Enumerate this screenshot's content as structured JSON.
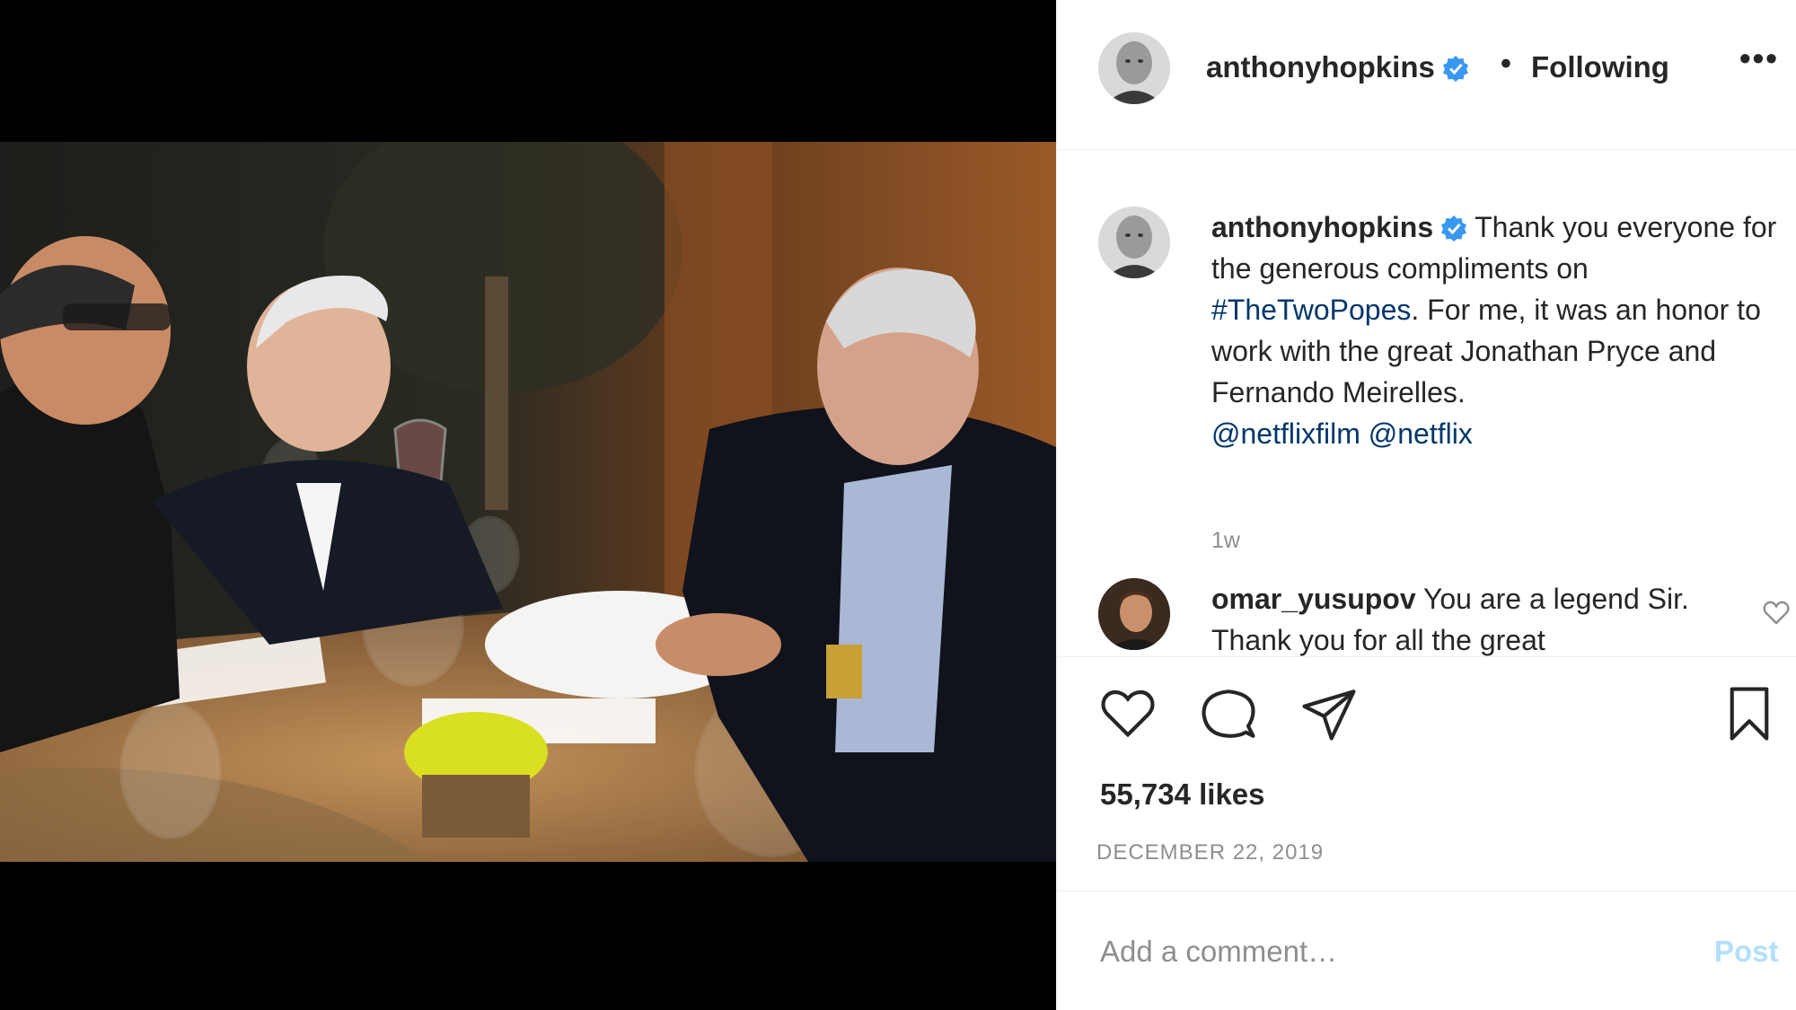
{
  "post": {
    "author": "anthonyhopkins",
    "follow_status": "Following",
    "separator": "•",
    "more_icon": "more-horizontal-icon",
    "more_label": "•••",
    "verified_color": "#3897f0"
  },
  "caption": {
    "username": "anthonyhopkins",
    "text_before": "Thank you everyone for the generous compliments on ",
    "hashtag": "#TheTwoPopes",
    "text_after": ". For me, it was an honor to work with the great Jonathan Pryce and Fernando Meirelles.",
    "mention_1": "@netflixfilm",
    "mention_2": "@netflix",
    "time": "1w"
  },
  "comment": {
    "username": "omar_yusupov",
    "text": "You are a legend Sir. Thank you for all the great"
  },
  "engagement": {
    "likes": "55,734 likes",
    "date": "DECEMBER 22, 2019"
  },
  "add_comment": {
    "placeholder": "Add a comment…",
    "post_label": "Post"
  },
  "colors": {
    "text": "#262626",
    "muted": "#8e8e8e",
    "link": "#00376b",
    "post_disabled": "#b2dffc"
  }
}
